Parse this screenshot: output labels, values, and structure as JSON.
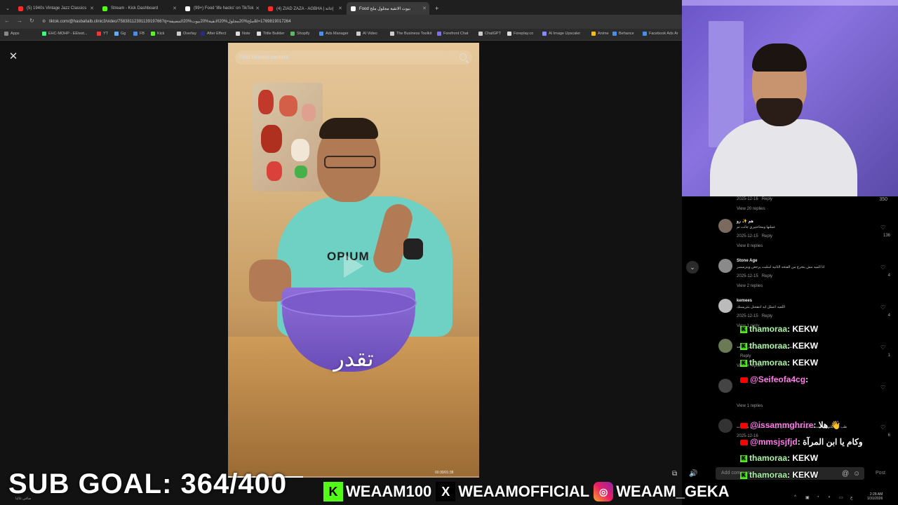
{
  "browser": {
    "tabs": [
      {
        "title": "(5) 1940s Vintage Jazz Classics",
        "color": "#ff2a2a"
      },
      {
        "title": "Stream - Kick Dashboard",
        "color": "#53fc18"
      },
      {
        "title": "(99+) Food 'life hacks' on TikTok",
        "color": "#ffffff"
      },
      {
        "title": "(4) ZIAD ZAZA - AGBHA | إغاثة",
        "color": "#ff2a2a"
      },
      {
        "title": "Food بيوت الانقية مجلول ملح",
        "color": "#ffffff"
      }
    ],
    "url": "tiktok.com/@hasbaltalb.clinic3/video/7583811239113919766?q=ملح%20مجلول%20الانقية%20بيوت%20التنضيفة&t=1769819017264",
    "bookmarks": [
      "Apps",
      "EHC-MOHP - EEtest...",
      "YT",
      "Gg",
      "FB",
      "Kick",
      "Overlay",
      "After Effect",
      "Note",
      "Tittle Builder",
      "Shopify",
      "Ads Manager",
      "AI Video",
      "The Business Toolkit",
      "Forefront Chat",
      "ChatGPT",
      "Foreplay.co",
      "AI Image Upscaler",
      "Anime",
      "Behance",
      "Facebook Ads Ar"
    ]
  },
  "video": {
    "search_placeholder": "Find related content",
    "caption": "تقدر",
    "shirt_logo": "OPIUM",
    "time": "00:30/01:38",
    "progress": 0.3
  },
  "comments": {
    "top_date": "2025-12-16",
    "top_reply": "Reply",
    "top_likes": "350",
    "top_view_replies": "View 20 replies",
    "items": [
      {
        "name": "هم ✨ رو",
        "text": "عملتها ومحاحتيري جاتت تم",
        "date": "2025-12-15",
        "reply": "Reply",
        "likes": "136",
        "replies": "View 8 replies",
        "avatar": "#7a6a60"
      },
      {
        "name": "Stone Age",
        "text": "انا الميه مش بتخرج من الفتحه الثانيه امتلبت يرجعن ويتزسسر",
        "date": "2025-12-15",
        "reply": "Reply",
        "likes": "4",
        "replies": "View 2 replies",
        "avatar": "#8a8a8a"
      },
      {
        "name": "kemees",
        "text": "اللعبه اعملل ايه انتقحتل بتتريستك",
        "date": "2025-12-15",
        "reply": "Reply",
        "likes": "4",
        "replies": "View 1 reply",
        "avatar": "#bbbbbb"
      },
      {
        "name": "",
        "text": "طب ايش ري حسبر قالة والعلة بالتزع من نقس الفتحه",
        "date": "",
        "reply": "Reply",
        "likes": "1",
        "replies": "View 4 replies",
        "avatar": "#6b7a55"
      },
      {
        "name": "",
        "text": "",
        "date": "",
        "reply": "",
        "likes": "",
        "replies": "View 1 replies",
        "avatar": "#444444"
      },
      {
        "name": "",
        "text": "طب انا عملتها والحمد لله كل حاجه كويسه بس في حاجه بسيطه في مشكلات",
        "date": "2025-12-16",
        "reply": "",
        "likes": "6",
        "replies": "",
        "avatar": "#333333"
      }
    ],
    "add_comment": "Add comment...",
    "post": "Post"
  },
  "chat": [
    {
      "platform": "kick",
      "user": "thamoraa",
      "message": "KEKW"
    },
    {
      "platform": "kick",
      "user": "thamoraa",
      "message": "KEKW"
    },
    {
      "platform": "kick",
      "user": "thamoraa",
      "message": "KEKW"
    },
    {
      "platform": "yt",
      "user": "@Seifeofa4cg",
      "message": ""
    },
    {
      "platform": "yt",
      "user": "@issammghrire",
      "message": "هلا 👋"
    },
    {
      "platform": "yt",
      "user": "@mmsjsjfjd",
      "message": "وكام يا ابن المرآة"
    },
    {
      "platform": "kick",
      "user": "thamoraa",
      "message": "KEKW"
    },
    {
      "platform": "kick",
      "user": "thamoraa",
      "message": "KEKW"
    }
  ],
  "stream": {
    "sub_goal": "SUB GOAL: 364/400",
    "kick_handle": "WEAAM100",
    "x_handle": "WEAAMOFFICIAL",
    "ig_handle": "WEAAM_GEKA"
  },
  "taskbar": {
    "clock_time": "2:28 AM",
    "clock_date": "1/31/2026",
    "weather": "صافي غالبا"
  },
  "colors": {
    "kick": "#53fc18",
    "youtube": "#ff0000",
    "chat_user": "#a9f7a2",
    "yt_user": "#ff7dea"
  }
}
